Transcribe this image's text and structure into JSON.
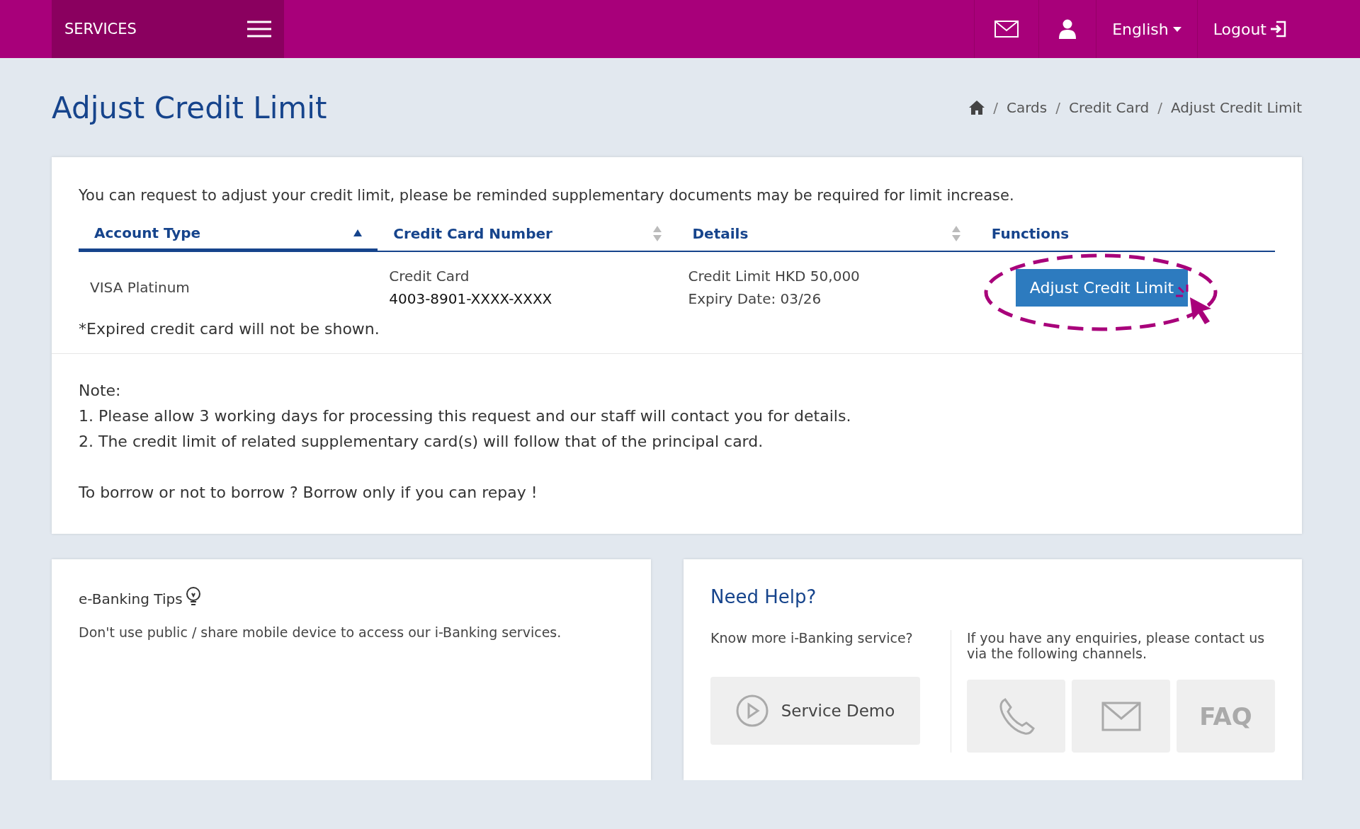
{
  "header": {
    "menu_label": "SERVICES",
    "language": "English",
    "logout": "Logout"
  },
  "title": "Adjust Credit Limit",
  "breadcrumb": {
    "separator": "/",
    "items": [
      "Cards",
      "Credit Card",
      "Adjust Credit Limit"
    ]
  },
  "intro": "You can request to adjust your credit limit, please be reminded supplementary documents may be required for limit increase.",
  "table": {
    "columns": [
      {
        "label": "Account Type",
        "sortable": true,
        "sorted": true
      },
      {
        "label": "Credit Card Number",
        "sortable": true,
        "sorted": false
      },
      {
        "label": "Details",
        "sortable": true,
        "sorted": false
      },
      {
        "label": "Functions",
        "sortable": false,
        "sorted": false
      }
    ],
    "rows": [
      {
        "account_type": "VISA Platinum",
        "card_type": "Credit Card",
        "card_number": "4003-8901-XXXX-XXXX",
        "credit_limit": "Credit Limit HKD 50,000",
        "expiry": "Expiry Date: 03/26",
        "action": "Adjust Credit Limit"
      }
    ]
  },
  "footnote": "*Expired credit card will not be shown.",
  "note": {
    "heading": "Note:",
    "items": [
      "1. Please allow 3 working days for processing this request and our staff will contact you for details.",
      "2. The credit limit of related supplementary card(s) will follow that of the principal card."
    ],
    "slogan": "To borrow or not to borrow ? Borrow only if you can repay !"
  },
  "tips": {
    "title": "e-Banking Tips",
    "text": "Don't use public / share mobile device to access our i-Banking services."
  },
  "help": {
    "title": "Need Help?",
    "left_text": "Know more i-Banking service?",
    "demo_button": "Service Demo",
    "right_text": "If you have any enquiries, please contact us via the following channels.",
    "channels": [
      {
        "kind": "phone"
      },
      {
        "kind": "email"
      },
      {
        "kind": "faq",
        "label": "FAQ"
      }
    ]
  }
}
